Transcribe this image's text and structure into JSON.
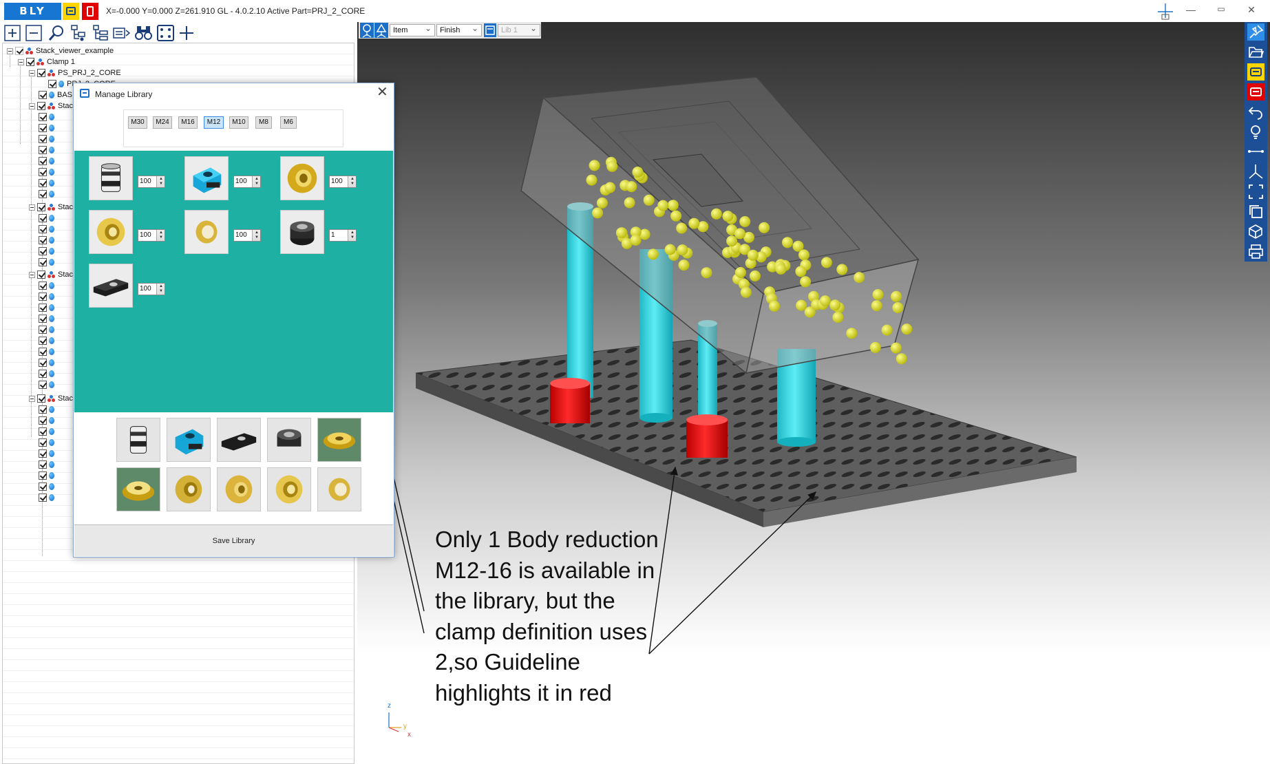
{
  "app": {
    "logo": "BLY",
    "status": "X=-0.000 Y=0.000 Z=261.910   GL - 4.0.2.10 Active Part=PRJ_2_CORE",
    "window_controls": [
      "—",
      "▭",
      "✕"
    ]
  },
  "tree": {
    "rows": [
      {
        "label": "Stack_viewer_example",
        "icon": "group"
      },
      {
        "label": "Clamp 1",
        "icon": "group"
      },
      {
        "label": "PS_PRJ_2_CORE",
        "icon": "group"
      },
      {
        "label": "PRJ_2_CORE",
        "icon": "part"
      },
      {
        "label": "BAS",
        "icon": "part"
      },
      {
        "label": "Stac",
        "icon": "group"
      },
      {
        "label": "Stac",
        "icon": "group"
      },
      {
        "label": "Stac",
        "icon": "group"
      },
      {
        "label": "Stac",
        "icon": "group"
      }
    ]
  },
  "viewport": {
    "toolbar": {
      "select1": "Item",
      "select2": "Finish",
      "select3": "Lib 1"
    },
    "axes": {
      "x": "x",
      "y": "y",
      "z": "z"
    }
  },
  "dialog": {
    "title": "Manage Library",
    "close": "✕",
    "sizes": [
      "M30",
      "M24",
      "M16",
      "M12",
      "M10",
      "M8",
      "M6"
    ],
    "selected_size": "M12",
    "library_items": [
      {
        "name": "stack-body",
        "qty": "100"
      },
      {
        "name": "clamp-cyan",
        "qty": "100"
      },
      {
        "name": "ring-gold-large",
        "qty": "100"
      },
      {
        "name": "ring-gold",
        "qty": "100"
      },
      {
        "name": "ring-gold-thin",
        "qty": "100"
      },
      {
        "name": "body-reduction-m12-16",
        "qty": "1"
      },
      {
        "name": "base-black",
        "qty": "100"
      }
    ],
    "save_label": "Save Library"
  },
  "annotation": {
    "text": "Only 1 Body reduction M12-16 is available in the library, but the clamp definition uses 2,so Guideline highlights it in red"
  },
  "colors": {
    "accent_blue": "#1c6fc9",
    "teal_panel": "#1fb0a4",
    "highlight_red": "#e00000",
    "cyan_stack": "#2fd4e0",
    "yellow_ball": "#d8d81a"
  }
}
